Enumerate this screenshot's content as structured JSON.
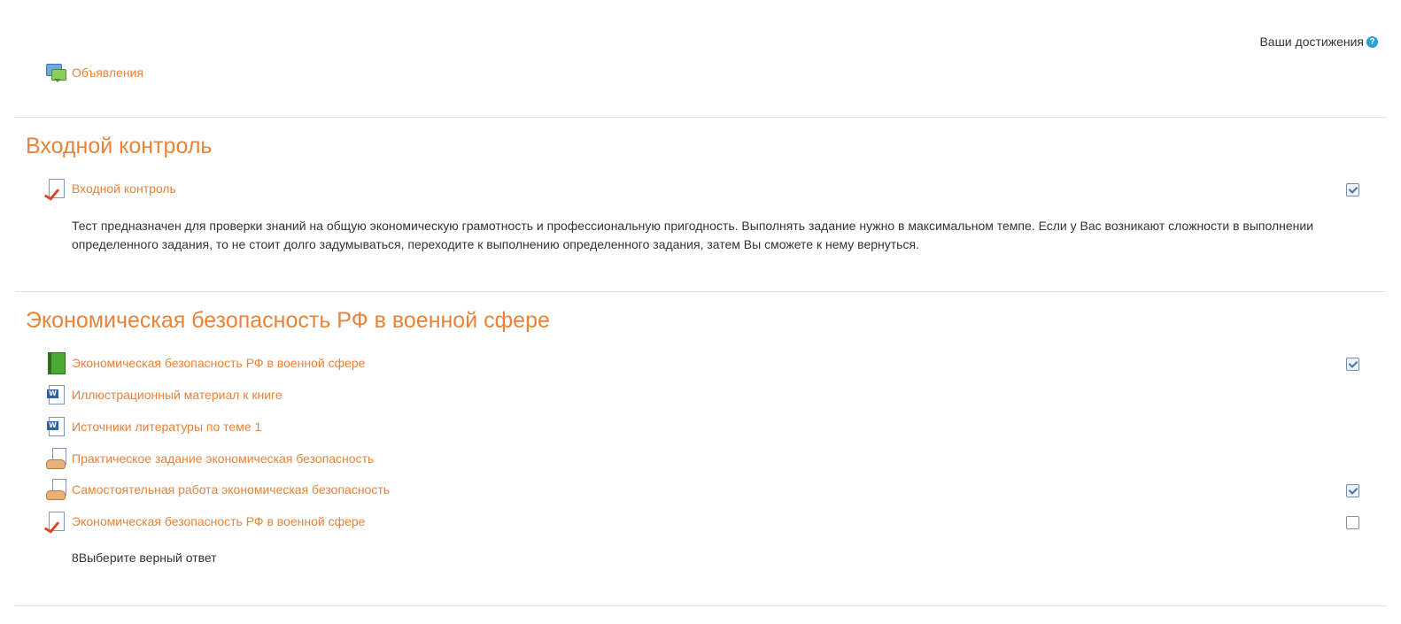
{
  "header": {
    "achievements_label": "Ваши достижения",
    "help_glyph": "?"
  },
  "top_activity": {
    "label": "Объявления",
    "icon": "forum-icon"
  },
  "sections": [
    {
      "title": "Входной контроль",
      "activities": [
        {
          "label": "Входной контроль",
          "icon": "quiz-icon",
          "completed": true
        }
      ],
      "description": "Тест предназначен для проверки знаний на общую экономическую грамотность и профессиональную пригодность. Выполнять задание нужно в максимальном темпе. Если у Вас возникают сложности в выполнении определенного задания, то не стоит долго задумываться, переходите к выполнению определенного задания, затем Вы сможете к нему вернуться."
    },
    {
      "title": "Экономическая безопасность РФ в военной сфере",
      "activities": [
        {
          "label": "Экономическая безопасность РФ в военной сфере",
          "icon": "book-icon",
          "completed": true
        },
        {
          "label": "Иллюстрационный материал к книге",
          "icon": "word-document-icon"
        },
        {
          "label": "Источники литературы по теме 1",
          "icon": "word-document-icon"
        },
        {
          "label": "Практическое задание экономическая безопасность",
          "icon": "assignment-icon"
        },
        {
          "label": "Самостоятельная работа экономическая безопасность",
          "icon": "assignment-icon",
          "completed": true
        },
        {
          "label": "Экономическая безопасность РФ в военной сфере",
          "icon": "quiz-icon",
          "completed": false
        }
      ],
      "description": "8Выберите верный ответ"
    }
  ],
  "colors": {
    "link": "#e8833a",
    "text": "#333333",
    "separator": "#dee2e6",
    "help": "#2a9fd6"
  }
}
